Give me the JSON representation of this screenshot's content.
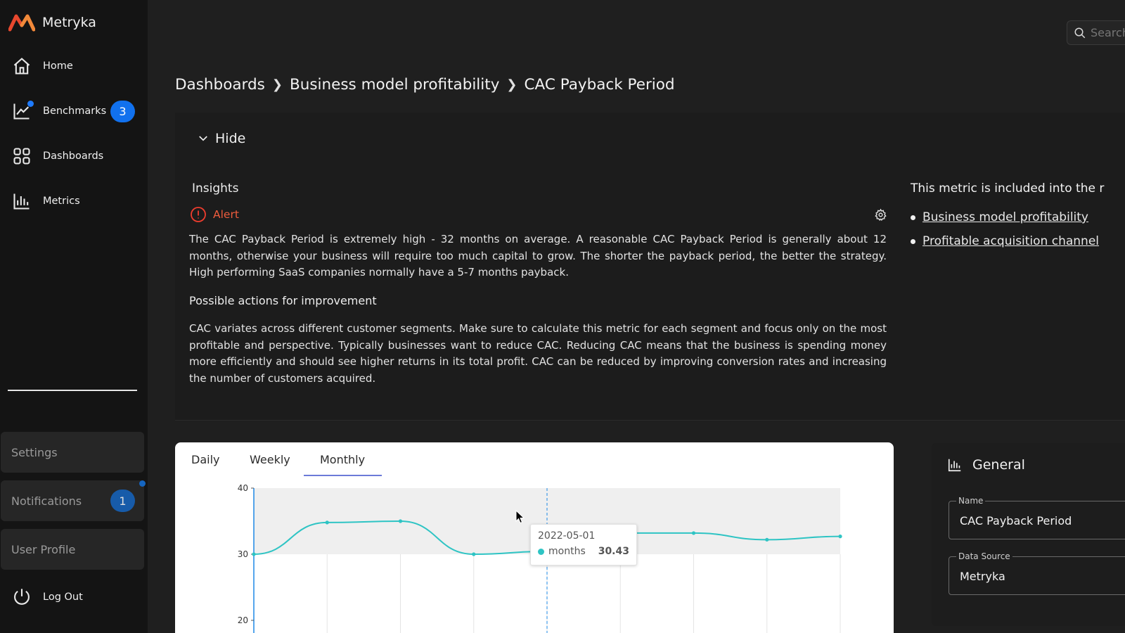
{
  "brand": {
    "name": "Metryka"
  },
  "nav": {
    "items": [
      {
        "label": "Home"
      },
      {
        "label": "Benchmarks",
        "badge": "3"
      },
      {
        "label": "Dashboards"
      },
      {
        "label": "Metrics"
      }
    ],
    "bottom": [
      {
        "label": "Settings"
      },
      {
        "label": "Notifications",
        "badge": "1"
      },
      {
        "label": "User Profile"
      },
      {
        "label": "Log Out"
      }
    ]
  },
  "search": {
    "placeholder": "Search"
  },
  "breadcrumb": [
    "Dashboards",
    "Business model profitability",
    "CAC Payback Period"
  ],
  "panel": {
    "toggle_label": "Hide",
    "insights_title": "Insights",
    "alert_label": "Alert",
    "paragraph1": "The CAC Payback Period is extremely high - 32 months on average. A reasonable CAC Payback Period is generally about 12 months, otherwise your business will require too much capital to grow. The shorter the payback period, the better the strategy. High performing SaaS companies normally have a 5-7 months payback.",
    "actions_title": "Possible actions for improvement",
    "paragraph2": "CAC variates across different customer segments. Make sure to calculate this metric for each segment and focus only on the most profitable and perspective. Typically businesses want to reduce CAC. Reducing CAC means that the business is spending money more efficiently and should see higher returns in its total profit. CAC can be reduced by improving conversion rates and increasing the number of customers acquired.",
    "included_title": "This metric is included into the r",
    "included_items": [
      "Business model profitability",
      "Profitable acquisition channel"
    ]
  },
  "chart": {
    "tabs": [
      "Daily",
      "Weekly",
      "Monthly"
    ],
    "active_tab": "Monthly",
    "tooltip": {
      "date": "2022-05-01",
      "series": "months",
      "value": "30.43"
    }
  },
  "chart_data": {
    "type": "line",
    "series": [
      {
        "name": "months",
        "values": [
          30.0,
          34.8,
          35.0,
          30.0,
          30.43,
          33.2,
          33.2,
          32.2,
          32.7
        ]
      }
    ],
    "y_ticks": [
      "40",
      "30",
      "20"
    ],
    "ylim": [
      20,
      40
    ],
    "band": [
      30,
      40
    ],
    "color": "#2ec4c4",
    "highlight_index": 4
  },
  "general": {
    "title": "General",
    "fields": [
      {
        "label": "Name",
        "value": "CAC Payback Period"
      },
      {
        "label": "Data Source",
        "value": "Metryka"
      }
    ]
  }
}
